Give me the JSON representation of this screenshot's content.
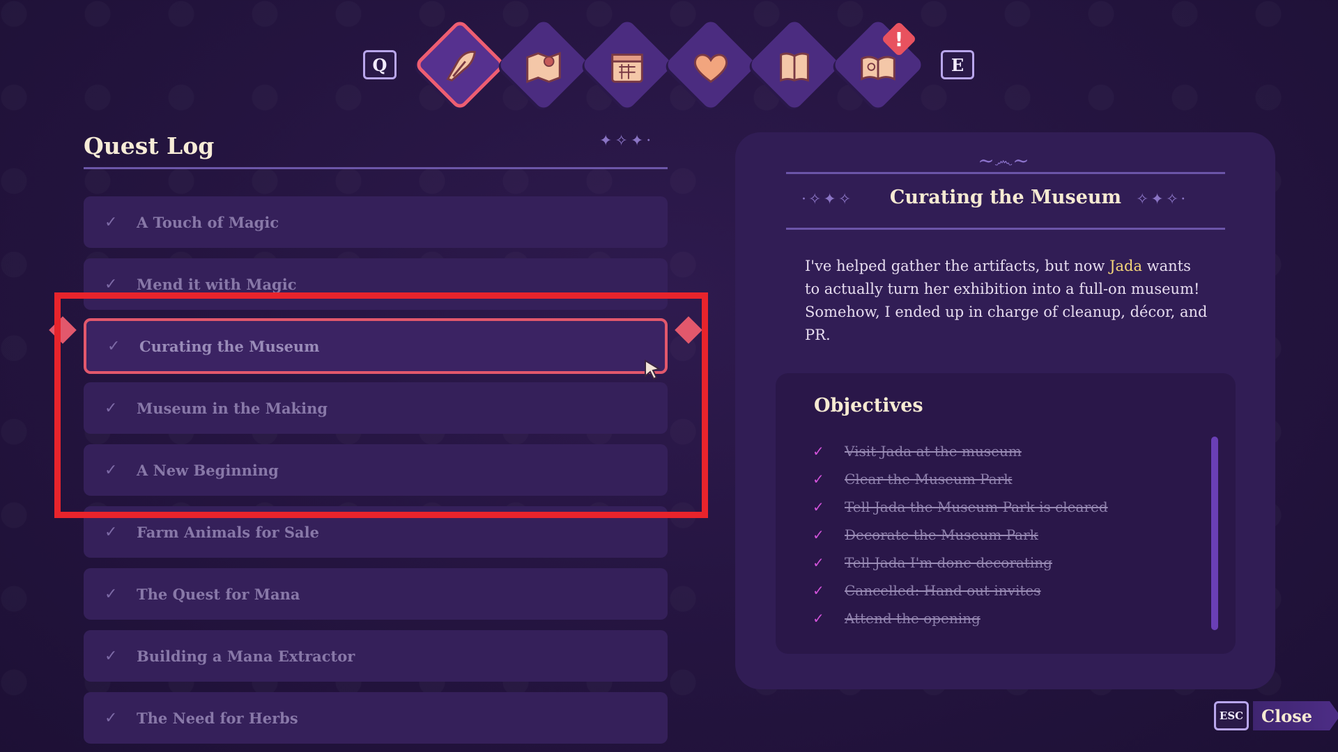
{
  "hotkeys": {
    "prev": "Q",
    "next": "E",
    "close_key": "ESC"
  },
  "tabs": [
    {
      "icon": "quill-icon",
      "active": true
    },
    {
      "icon": "map-icon",
      "active": false
    },
    {
      "icon": "calendar-icon",
      "active": false
    },
    {
      "icon": "heart-icon",
      "active": false
    },
    {
      "icon": "book-icon",
      "active": false
    },
    {
      "icon": "journal-icon",
      "active": false,
      "alert": "!"
    }
  ],
  "quest_log": {
    "title": "Quest Log",
    "quests": [
      {
        "label": "A Touch of Magic",
        "done": true
      },
      {
        "label": "Mend it with Magic",
        "done": true
      },
      {
        "label": "Curating the Museum",
        "done": true,
        "selected": true
      },
      {
        "label": "Museum in the Making",
        "done": true
      },
      {
        "label": "A New Beginning",
        "done": true
      },
      {
        "label": "Farm Animals for Sale",
        "done": true
      },
      {
        "label": "The Quest for Mana",
        "done": true
      },
      {
        "label": "Building a Mana Extractor",
        "done": true
      },
      {
        "label": "The Need for Herbs",
        "done": true
      }
    ]
  },
  "detail": {
    "title": "Curating the Museum",
    "description_pre": "I've helped gather the artifacts, but now ",
    "description_name": "Jada",
    "description_post": " wants to actually turn her exhibition into a full-on museum! Somehow, I ended up in charge of cleanup, décor, and PR.",
    "objectives_title": "Objectives",
    "objectives": [
      "Visit Jada at the museum",
      "Clear the Museum Park",
      "Tell Jada the Museum Park is cleared",
      "Decorate the Museum Park",
      "Tell Jada I'm done decorating",
      "Cancelled: Hand out invites",
      "Attend the opening"
    ]
  },
  "close_button": {
    "label": "Close"
  },
  "colors": {
    "background": "#24143f",
    "accent_selected": "#e2586c",
    "highlight_name": "#f5d77a",
    "objective_check": "#d052d8",
    "annotation_box": "#e8242c"
  }
}
